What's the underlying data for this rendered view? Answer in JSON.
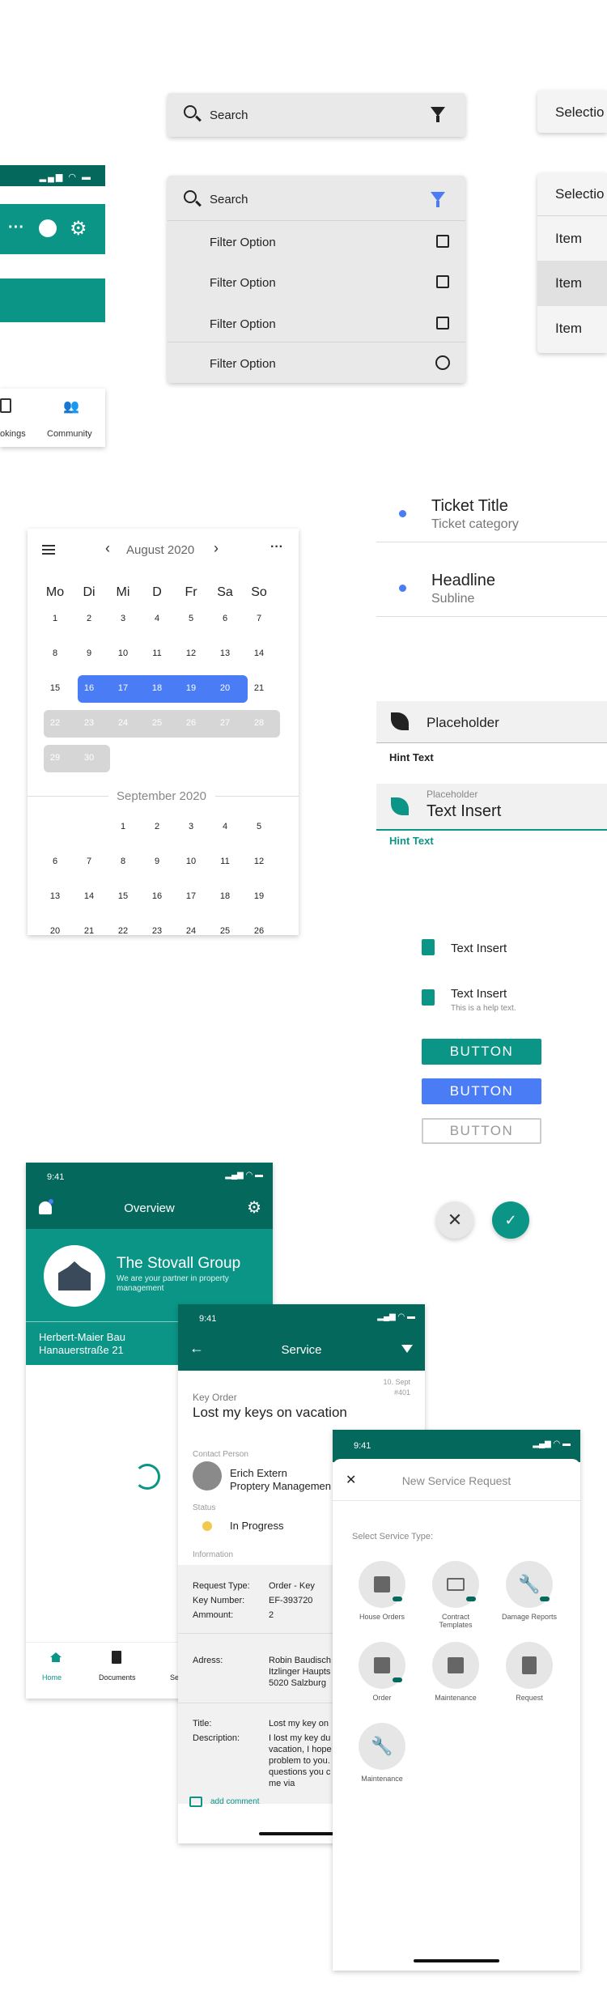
{
  "search_bar": {
    "placeholder": "Search"
  },
  "filter_panel": {
    "search_placeholder": "Search",
    "options": [
      "Filter Option",
      "Filter Option",
      "Filter Option",
      "Filter Option"
    ]
  },
  "selection": {
    "label": "Selectio",
    "header": "Selectio",
    "items": [
      "Item",
      "Item",
      "Item"
    ]
  },
  "nav_bottom": {
    "bookings": "okings",
    "community": "Community"
  },
  "list_items": [
    {
      "title": "Ticket Title",
      "sub": "Ticket category"
    },
    {
      "title": "Headline",
      "sub": "Subline"
    }
  ],
  "inputs": {
    "placeholder_1": "Placeholder",
    "hint_1": "Hint Text",
    "placeholder_2": "Placeholder",
    "value_2": "Text Insert",
    "hint_2": "Hint Text"
  },
  "text_inserts": {
    "t1": "Text Insert",
    "t2": "Text Insert",
    "help": "This is a help text."
  },
  "buttons": {
    "b1": "BUTTON",
    "b2": "BUTTON",
    "b3": "BUTTON"
  },
  "calendar": {
    "month": "August 2020",
    "next_month": "September 2020",
    "weekdays": [
      "Mo",
      "Di",
      "Mi",
      "D",
      "Fr",
      "Sa",
      "So"
    ],
    "aug_rows": [
      [
        "1",
        "2",
        "3",
        "4",
        "5",
        "6",
        "7"
      ],
      [
        "8",
        "9",
        "10",
        "11",
        "12",
        "13",
        "14"
      ],
      [
        "15",
        "16",
        "17",
        "18",
        "19",
        "20",
        "21"
      ],
      [
        "22",
        "23",
        "24",
        "25",
        "26",
        "27",
        "28"
      ],
      [
        "29",
        "30"
      ]
    ],
    "sep_rows": [
      [
        "",
        "",
        "1",
        "2",
        "3",
        "4",
        "5"
      ],
      [
        "6",
        "7",
        "8",
        "9",
        "10",
        "11",
        "12"
      ],
      [
        "13",
        "14",
        "15",
        "16",
        "17",
        "18",
        "19"
      ],
      [
        "20",
        "21",
        "22",
        "23",
        "24",
        "25",
        "26"
      ]
    ]
  },
  "overview": {
    "time": "9:41",
    "title": "Overview",
    "company": "The Stovall Group",
    "tagline": "We are your partner in property management",
    "addr1": "Herbert-Maier Bau",
    "addr2": "Hanauerstraße 21",
    "nav": [
      "Home",
      "Documents",
      "Se"
    ]
  },
  "service": {
    "time": "9:41",
    "title": "Service",
    "date": "10. Sept",
    "num": "#401",
    "category": "Key Order",
    "headline": "Lost my keys on vacation",
    "contact_label": "Contact Person",
    "contact_name": "Erich Extern",
    "contact_role": "Proptery Managemen",
    "status_label": "Status",
    "status": "In Progress",
    "info_label": "Information",
    "rt_label": "Request Type:",
    "rt_value": "Order - Key",
    "kn_label": "Key Number:",
    "kn_value": "EF-393720",
    "am_label": "Ammount:",
    "am_value": "2",
    "adr_label": "Adress:",
    "adr_1": "Robin Baudisch",
    "adr_2": "Itzlinger Haupts",
    "adr_3": "5020 Salzburg",
    "title_label": "Title:",
    "title_value": "Lost my key on",
    "desc_label": "Description:",
    "desc_1": "I lost my key du",
    "desc_2": "vacation, I hope",
    "desc_3": "problem to you.",
    "desc_4": "questions you c",
    "desc_5": "me via",
    "add_comment": "add comment"
  },
  "new_request": {
    "time": "9:41",
    "title": "New Service Request",
    "section": "Select Service Type:",
    "types": [
      "House Orders",
      "Contract Templates",
      "Damage Reports",
      "Order",
      "Maintenance",
      "Request",
      "Maintenance"
    ]
  },
  "colors": {
    "teal": "#0b9586",
    "dark_teal": "#05685d",
    "blue": "#4a7cf6",
    "status_yellow": "#f2c94c"
  }
}
